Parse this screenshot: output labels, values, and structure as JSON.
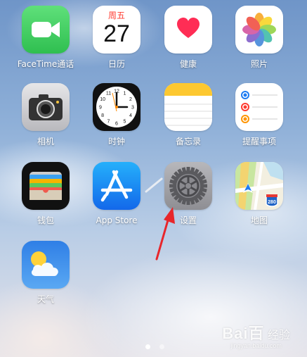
{
  "apps": [
    {
      "id": "facetime",
      "label": "FaceTime通话",
      "icon": "facetime-icon"
    },
    {
      "id": "calendar",
      "label": "日历",
      "icon": "calendar-icon",
      "weekday": "周五",
      "day": "27"
    },
    {
      "id": "health",
      "label": "健康",
      "icon": "health-heart-icon"
    },
    {
      "id": "photos",
      "label": "照片",
      "icon": "photos-flower-icon"
    },
    {
      "id": "camera",
      "label": "相机",
      "icon": "camera-icon"
    },
    {
      "id": "clock",
      "label": "时钟",
      "icon": "clock-icon",
      "numerals": [
        "12",
        "1",
        "2",
        "3",
        "4",
        "5",
        "6",
        "7",
        "8",
        "9",
        "10",
        "11"
      ]
    },
    {
      "id": "notes",
      "label": "备忘录",
      "icon": "notes-icon"
    },
    {
      "id": "reminders",
      "label": "提醒事项",
      "icon": "reminders-icon"
    },
    {
      "id": "wallet",
      "label": "钱包",
      "icon": "wallet-icon"
    },
    {
      "id": "appstore",
      "label": "App Store",
      "icon": "app-store-icon"
    },
    {
      "id": "settings",
      "label": "设置",
      "icon": "settings-gear-icon"
    },
    {
      "id": "maps",
      "label": "地图",
      "icon": "maps-icon",
      "route": "280"
    },
    {
      "id": "weather",
      "label": "天气",
      "icon": "weather-icon"
    }
  ],
  "page_indicator": {
    "count": 2,
    "active": 0
  },
  "annotation": {
    "color": "#e8262b"
  },
  "watermark": {
    "brand": "Bai",
    "brand2": "百",
    "sub": "经验",
    "url": "jingyan.baidu.com"
  },
  "colors": {
    "facetime": "#35c95a",
    "calendar_red": "#ff3b30",
    "health_heart": "#ff2d55",
    "notes_yellow": "#fdc830",
    "appstore_blue": "#1c8dfb",
    "weather_blue": "#3a8ff0"
  }
}
